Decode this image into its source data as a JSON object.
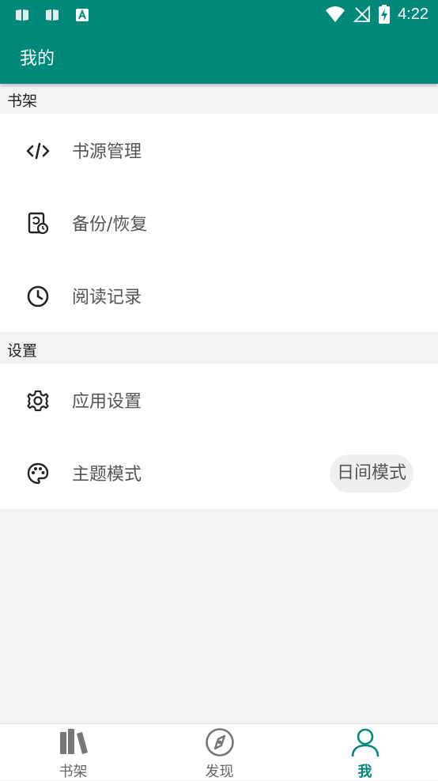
{
  "status_bar": {
    "time": "4:22",
    "icons": [
      "book-notification-icon",
      "book-notification-icon",
      "text-notification-icon",
      "wifi-icon",
      "no-signal-icon",
      "battery-charging-icon"
    ]
  },
  "appbar": {
    "title": "我的"
  },
  "sections": [
    {
      "header": "书架",
      "items": [
        {
          "label": "书源管理",
          "icon": "code-icon"
        },
        {
          "label": "备份/恢复",
          "icon": "backup-restore-icon"
        },
        {
          "label": "阅读记录",
          "icon": "clock-icon"
        }
      ]
    },
    {
      "header": "设置",
      "items": [
        {
          "label": "应用设置",
          "icon": "gear-icon"
        },
        {
          "label": "主题模式",
          "icon": "palette-icon",
          "value": "日间模式"
        }
      ]
    }
  ],
  "bottom_nav": [
    {
      "label": "书架",
      "icon": "bookshelf-icon",
      "active": false
    },
    {
      "label": "发现",
      "icon": "compass-icon",
      "active": false
    },
    {
      "label": "我",
      "icon": "person-icon",
      "active": true
    }
  ],
  "colors": {
    "primary": "#00897b",
    "background": "#f2f2f2",
    "text_secondary": "#555555"
  }
}
